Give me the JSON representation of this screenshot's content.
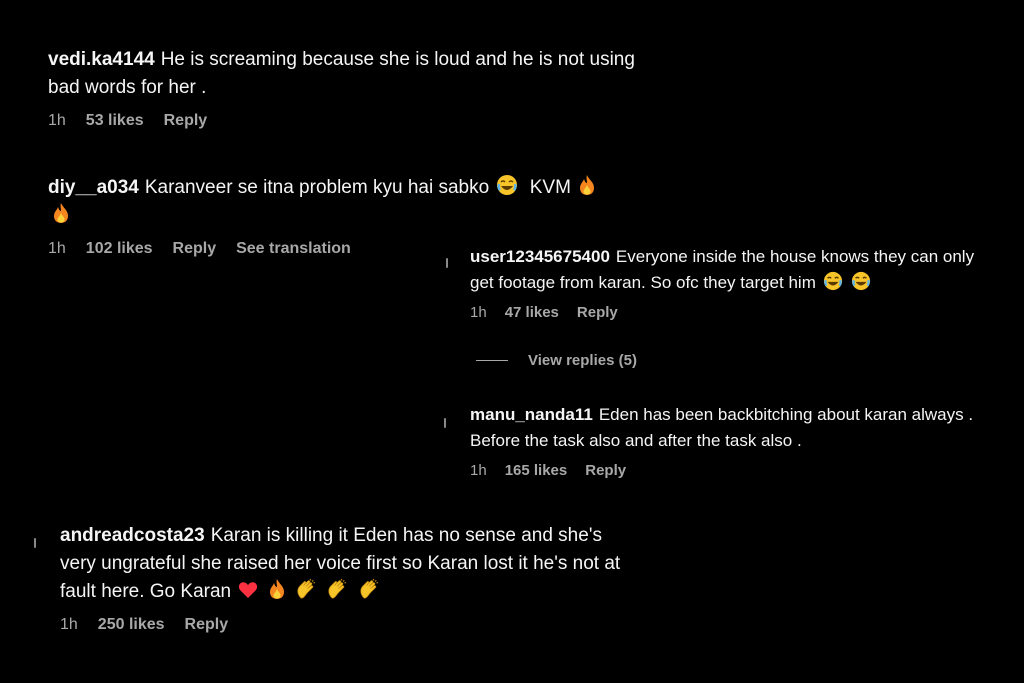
{
  "comments": [
    {
      "username": "vedi.ka4144",
      "text": "He is screaming because she is loud and he is not using bad words for her .",
      "time": "1h",
      "likes": "53 likes",
      "reply_label": "Reply"
    },
    {
      "username": "diy__a034",
      "text": "Karanveer se itna problem kyu hai sabko",
      "text_suffix": "KVM",
      "time": "1h",
      "likes": "102 likes",
      "reply_label": "Reply",
      "translation_label": "See translation"
    },
    {
      "username": "user12345675400",
      "text": "Everyone inside the house knows they can only get footage from karan. So ofc they target him",
      "time": "1h",
      "likes": "47 likes",
      "reply_label": "Reply"
    },
    {
      "username": "manu_nanda11",
      "text": "Eden has been backbitching about karan always . Before the task also and after the task also .",
      "time": "1h",
      "likes": "165 likes",
      "reply_label": "Reply"
    },
    {
      "username": "andreadcosta23",
      "text": "Karan is killing it Eden has no sense and she's very ungrateful she raised her voice first so Karan lost it he's not at fault here. Go Karan",
      "time": "1h",
      "likes": "250 likes",
      "reply_label": "Reply"
    }
  ],
  "view_replies_label": "View replies (5)",
  "icons": {
    "laugh": "face-with-tears-of-joy-icon",
    "fire": "fire-icon",
    "heart": "red-heart-icon",
    "clap": "clapping-hands-icon"
  },
  "colors": {
    "background": "#000000",
    "text": "#f5f5f5",
    "meta": "#a8a8a8",
    "heart": "#ff3040"
  }
}
